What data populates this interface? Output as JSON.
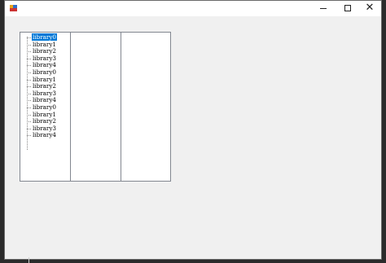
{
  "window": {
    "icon": "app-icon",
    "controls": {
      "minimize": "minimize-icon",
      "maximize": "maximize-icon",
      "close": "close-icon",
      "close_glyph": "✕"
    }
  },
  "tree_items": [
    {
      "label": "library0",
      "selected": true
    },
    {
      "label": "library1",
      "selected": false
    },
    {
      "label": "library2",
      "selected": false
    },
    {
      "label": "library3",
      "selected": false
    },
    {
      "label": "library4",
      "selected": false
    },
    {
      "label": "library0",
      "selected": false
    },
    {
      "label": "library1",
      "selected": false
    },
    {
      "label": "library2",
      "selected": false
    },
    {
      "label": "library3",
      "selected": false
    },
    {
      "label": "library4",
      "selected": false
    },
    {
      "label": "library0",
      "selected": false
    },
    {
      "label": "library1",
      "selected": false
    },
    {
      "label": "library2",
      "selected": false
    },
    {
      "label": "library3",
      "selected": false
    },
    {
      "label": "library4",
      "selected": false
    }
  ],
  "colors": {
    "selection": "#0078d7",
    "window_bg": "#f0f0f0",
    "list_bg": "#ffffff",
    "list_border": "#828790"
  }
}
